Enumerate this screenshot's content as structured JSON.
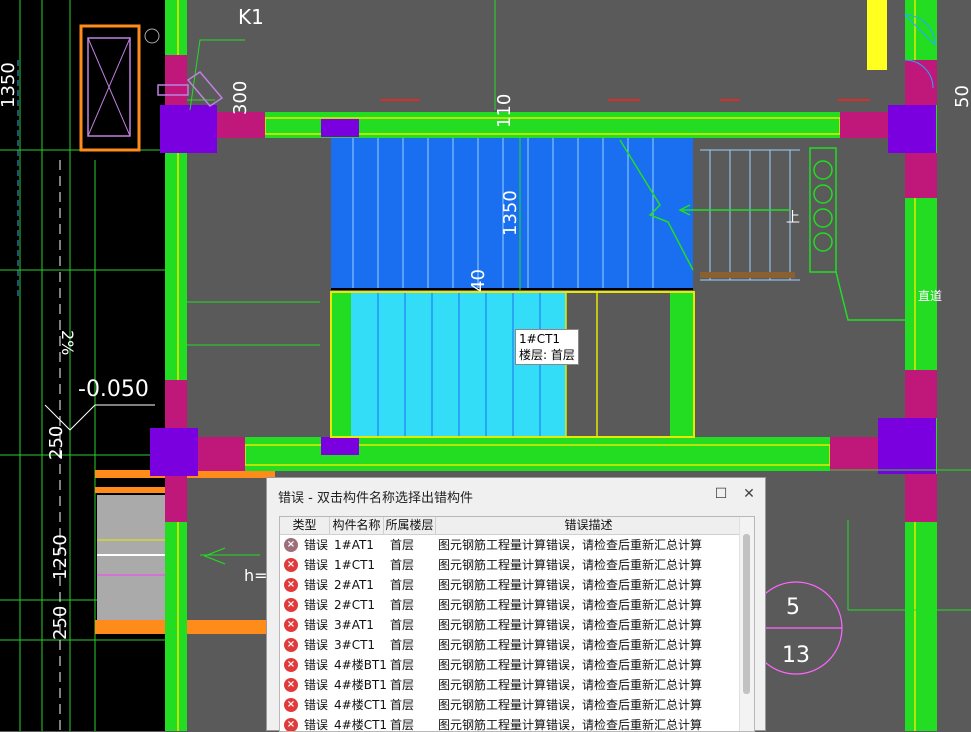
{
  "drawing": {
    "label_k1": "K1",
    "dim_1350_left": "1350",
    "dim_300": "300",
    "dim_110": "110",
    "dim_1350_stair": "1350",
    "dim_40": "40",
    "dim_50": "50",
    "dim_pct": "2%",
    "elevation": "-0.050",
    "dim_250_a": "250",
    "dim_1250": "1250",
    "dim_250_b": "250",
    "label_h": "h=",
    "label_up": "上",
    "label_shaft": "直道",
    "grid_bubble_top": "5",
    "grid_bubble_bottom": "13"
  },
  "tooltip": {
    "name": "1#CT1",
    "floor": "楼层: 首层"
  },
  "dialog": {
    "title": "错误 - 双击构件名称选择出错构件",
    "columns": [
      "类型",
      "构件名称",
      "所属楼层",
      "错误描述"
    ],
    "rows": [
      {
        "type": "错误",
        "name": "1#AT1",
        "floor": "首层",
        "desc": "图元钢筋工程量计算错误，请检查后重新汇总计算",
        "selected": true
      },
      {
        "type": "错误",
        "name": "1#CT1",
        "floor": "首层",
        "desc": "图元钢筋工程量计算错误，请检查后重新汇总计算"
      },
      {
        "type": "错误",
        "name": "2#AT1",
        "floor": "首层",
        "desc": "图元钢筋工程量计算错误，请检查后重新汇总计算"
      },
      {
        "type": "错误",
        "name": "2#CT1",
        "floor": "首层",
        "desc": "图元钢筋工程量计算错误，请检查后重新汇总计算"
      },
      {
        "type": "错误",
        "name": "3#AT1",
        "floor": "首层",
        "desc": "图元钢筋工程量计算错误，请检查后重新汇总计算"
      },
      {
        "type": "错误",
        "name": "3#CT1",
        "floor": "首层",
        "desc": "图元钢筋工程量计算错误，请检查后重新汇总计算"
      },
      {
        "type": "错误",
        "name": "4#楼BT1",
        "floor": "首层",
        "desc": "图元钢筋工程量计算错误，请检查后重新汇总计算"
      },
      {
        "type": "错误",
        "name": "4#楼BT1",
        "floor": "首层",
        "desc": "图元钢筋工程量计算错误，请检查后重新汇总计算"
      },
      {
        "type": "错误",
        "name": "4#楼CT1",
        "floor": "首层",
        "desc": "图元钢筋工程量计算错误，请检查后重新汇总计算"
      },
      {
        "type": "错误",
        "name": "4#楼CT1",
        "floor": "首层",
        "desc": "图元钢筋工程量计算错误，请检查后重新汇总计算"
      }
    ],
    "icons": {
      "maximize": "maximize-icon",
      "close": "close-icon",
      "error": "error-circle-icon"
    }
  },
  "colors": {
    "wall_green": "#22dd22",
    "column_magenta": "#c0187a",
    "column_purple": "#7a00e0",
    "stair_blue": "#1a6ff0",
    "stair_cyan": "#33ddf8",
    "line_yellow": "#e8e800",
    "error_red": "#e03a3a"
  }
}
